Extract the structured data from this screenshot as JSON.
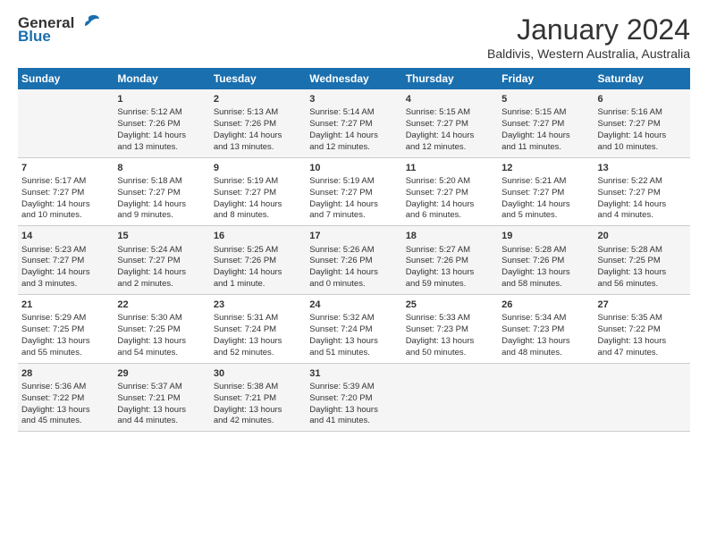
{
  "logo": {
    "general": "General",
    "blue": "Blue"
  },
  "title": "January 2024",
  "location": "Baldivis, Western Australia, Australia",
  "headers": [
    "Sunday",
    "Monday",
    "Tuesday",
    "Wednesday",
    "Thursday",
    "Friday",
    "Saturday"
  ],
  "weeks": [
    [
      {
        "day": "",
        "text": ""
      },
      {
        "day": "1",
        "text": "Sunrise: 5:12 AM\nSunset: 7:26 PM\nDaylight: 14 hours\nand 13 minutes."
      },
      {
        "day": "2",
        "text": "Sunrise: 5:13 AM\nSunset: 7:26 PM\nDaylight: 14 hours\nand 13 minutes."
      },
      {
        "day": "3",
        "text": "Sunrise: 5:14 AM\nSunset: 7:27 PM\nDaylight: 14 hours\nand 12 minutes."
      },
      {
        "day": "4",
        "text": "Sunrise: 5:15 AM\nSunset: 7:27 PM\nDaylight: 14 hours\nand 12 minutes."
      },
      {
        "day": "5",
        "text": "Sunrise: 5:15 AM\nSunset: 7:27 PM\nDaylight: 14 hours\nand 11 minutes."
      },
      {
        "day": "6",
        "text": "Sunrise: 5:16 AM\nSunset: 7:27 PM\nDaylight: 14 hours\nand 10 minutes."
      }
    ],
    [
      {
        "day": "7",
        "text": "Sunrise: 5:17 AM\nSunset: 7:27 PM\nDaylight: 14 hours\nand 10 minutes."
      },
      {
        "day": "8",
        "text": "Sunrise: 5:18 AM\nSunset: 7:27 PM\nDaylight: 14 hours\nand 9 minutes."
      },
      {
        "day": "9",
        "text": "Sunrise: 5:19 AM\nSunset: 7:27 PM\nDaylight: 14 hours\nand 8 minutes."
      },
      {
        "day": "10",
        "text": "Sunrise: 5:19 AM\nSunset: 7:27 PM\nDaylight: 14 hours\nand 7 minutes."
      },
      {
        "day": "11",
        "text": "Sunrise: 5:20 AM\nSunset: 7:27 PM\nDaylight: 14 hours\nand 6 minutes."
      },
      {
        "day": "12",
        "text": "Sunrise: 5:21 AM\nSunset: 7:27 PM\nDaylight: 14 hours\nand 5 minutes."
      },
      {
        "day": "13",
        "text": "Sunrise: 5:22 AM\nSunset: 7:27 PM\nDaylight: 14 hours\nand 4 minutes."
      }
    ],
    [
      {
        "day": "14",
        "text": "Sunrise: 5:23 AM\nSunset: 7:27 PM\nDaylight: 14 hours\nand 3 minutes."
      },
      {
        "day": "15",
        "text": "Sunrise: 5:24 AM\nSunset: 7:27 PM\nDaylight: 14 hours\nand 2 minutes."
      },
      {
        "day": "16",
        "text": "Sunrise: 5:25 AM\nSunset: 7:26 PM\nDaylight: 14 hours\nand 1 minute."
      },
      {
        "day": "17",
        "text": "Sunrise: 5:26 AM\nSunset: 7:26 PM\nDaylight: 14 hours\nand 0 minutes."
      },
      {
        "day": "18",
        "text": "Sunrise: 5:27 AM\nSunset: 7:26 PM\nDaylight: 13 hours\nand 59 minutes."
      },
      {
        "day": "19",
        "text": "Sunrise: 5:28 AM\nSunset: 7:26 PM\nDaylight: 13 hours\nand 58 minutes."
      },
      {
        "day": "20",
        "text": "Sunrise: 5:28 AM\nSunset: 7:25 PM\nDaylight: 13 hours\nand 56 minutes."
      }
    ],
    [
      {
        "day": "21",
        "text": "Sunrise: 5:29 AM\nSunset: 7:25 PM\nDaylight: 13 hours\nand 55 minutes."
      },
      {
        "day": "22",
        "text": "Sunrise: 5:30 AM\nSunset: 7:25 PM\nDaylight: 13 hours\nand 54 minutes."
      },
      {
        "day": "23",
        "text": "Sunrise: 5:31 AM\nSunset: 7:24 PM\nDaylight: 13 hours\nand 52 minutes."
      },
      {
        "day": "24",
        "text": "Sunrise: 5:32 AM\nSunset: 7:24 PM\nDaylight: 13 hours\nand 51 minutes."
      },
      {
        "day": "25",
        "text": "Sunrise: 5:33 AM\nSunset: 7:23 PM\nDaylight: 13 hours\nand 50 minutes."
      },
      {
        "day": "26",
        "text": "Sunrise: 5:34 AM\nSunset: 7:23 PM\nDaylight: 13 hours\nand 48 minutes."
      },
      {
        "day": "27",
        "text": "Sunrise: 5:35 AM\nSunset: 7:22 PM\nDaylight: 13 hours\nand 47 minutes."
      }
    ],
    [
      {
        "day": "28",
        "text": "Sunrise: 5:36 AM\nSunset: 7:22 PM\nDaylight: 13 hours\nand 45 minutes."
      },
      {
        "day": "29",
        "text": "Sunrise: 5:37 AM\nSunset: 7:21 PM\nDaylight: 13 hours\nand 44 minutes."
      },
      {
        "day": "30",
        "text": "Sunrise: 5:38 AM\nSunset: 7:21 PM\nDaylight: 13 hours\nand 42 minutes."
      },
      {
        "day": "31",
        "text": "Sunrise: 5:39 AM\nSunset: 7:20 PM\nDaylight: 13 hours\nand 41 minutes."
      },
      {
        "day": "",
        "text": ""
      },
      {
        "day": "",
        "text": ""
      },
      {
        "day": "",
        "text": ""
      }
    ]
  ]
}
